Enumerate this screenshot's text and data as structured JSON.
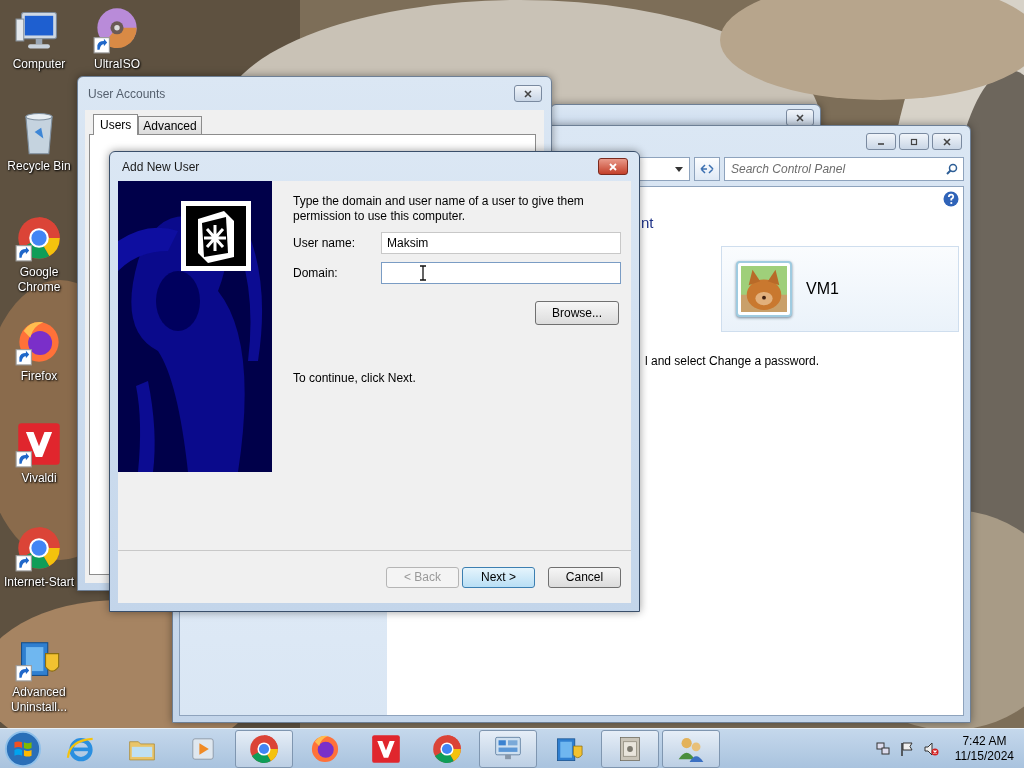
{
  "desktop": {
    "icons": [
      {
        "label": "Computer",
        "kind": "computer",
        "shortcut": false
      },
      {
        "label": "UltraISO",
        "kind": "disc",
        "shortcut": true
      },
      {
        "label": "Recycle Bin",
        "kind": "recycle",
        "shortcut": false
      },
      {
        "label": "Google Chrome",
        "kind": "chrome",
        "shortcut": true
      },
      {
        "label": "Firefox",
        "kind": "firefox",
        "shortcut": true
      },
      {
        "label": "Vivaldi",
        "kind": "vivaldi",
        "shortcut": true
      },
      {
        "label": "Internet-Start",
        "kind": "chrome",
        "shortcut": true
      },
      {
        "label": "Advanced Uninstall...",
        "kind": "installer",
        "shortcut": true
      }
    ]
  },
  "control_panel": {
    "search": {
      "placeholder": "Search Control Panel"
    },
    "heading": "nt",
    "account": {
      "name": "VM1"
    },
    "hint": "l and select Change a password."
  },
  "user_accounts": {
    "title": "User Accounts",
    "tabs": [
      {
        "label": "Users",
        "selected": true
      },
      {
        "label": "Advanced",
        "selected": false
      }
    ]
  },
  "dialog": {
    "title": "Add New User",
    "intro": "Type the domain and user name of a user to give them permission to use this computer.",
    "fields": [
      {
        "label": "User name:",
        "value": "Maksim",
        "focused": false
      },
      {
        "label": "Domain:",
        "focused": true
      }
    ],
    "browse": "Browse...",
    "continue": "To continue, click Next.",
    "buttons": [
      {
        "label": "< Back",
        "disabled": true,
        "default": false
      },
      {
        "label": "Next >",
        "disabled": false,
        "default": true
      },
      {
        "label": "Cancel",
        "disabled": false,
        "default": false
      }
    ]
  },
  "taskbar": {
    "items": [
      {
        "kind": "ie",
        "highlighted": false
      },
      {
        "kind": "folder",
        "highlighted": false
      },
      {
        "kind": "media",
        "highlighted": false
      },
      {
        "kind": "chrome",
        "highlighted": true
      },
      {
        "kind": "firefox",
        "highlighted": false
      },
      {
        "kind": "vivaldi",
        "highlighted": false
      },
      {
        "kind": "chrome",
        "highlighted": false
      },
      {
        "kind": "control",
        "highlighted": true
      },
      {
        "kind": "installer",
        "highlighted": false
      },
      {
        "kind": "safe",
        "highlighted": true
      },
      {
        "kind": "users",
        "highlighted": true
      }
    ],
    "tray": {
      "muted": true
    },
    "clock": {
      "time": "7:42 AM",
      "date": "11/15/2024"
    }
  }
}
